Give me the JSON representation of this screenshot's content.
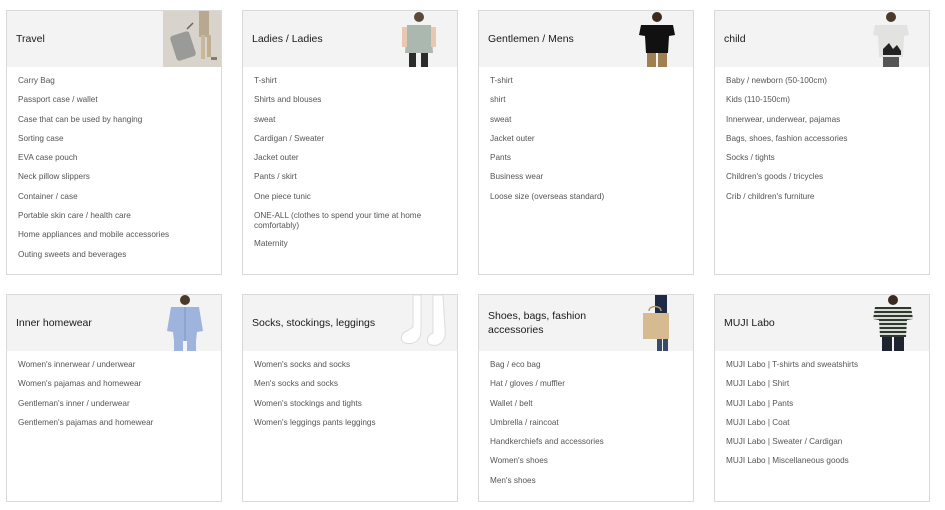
{
  "categories": [
    {
      "title": "Travel",
      "image": "suitcase-traveler",
      "items": [
        "Carry Bag",
        "Passport case / wallet",
        "Case that can be used by hanging",
        "Sorting case",
        "EVA case pouch",
        "Neck pillow slippers",
        "Container / case",
        "Portable skin care / health care",
        "Home appliances and mobile accessories",
        "Outing sweets and beverages"
      ]
    },
    {
      "title": "Ladies / Ladies",
      "image": "woman-grey-top",
      "items": [
        "T-shirt",
        "Shirts and blouses",
        "sweat",
        "Cardigan / Sweater",
        "Jacket outer",
        "Pants / skirt",
        "One piece tunic",
        "ONE-ALL (clothes to spend your time at home comfortably)",
        "Maternity"
      ]
    },
    {
      "title": "Gentlemen / Mens",
      "image": "man-black-tshirt",
      "items": [
        "T-shirt",
        "shirt",
        "sweat",
        "Jacket outer",
        "Pants",
        "Business wear",
        "Loose size (overseas standard)"
      ]
    },
    {
      "title": "child",
      "image": "child-print-tshirt",
      "items": [
        "Baby / newborn (50-100cm)",
        "Kids (110-150cm)",
        "Innerwear, underwear, pajamas",
        "Bags, shoes, fashion accessories",
        "Socks / tights",
        "Children's goods / tricycles",
        "Crib / children's furniture"
      ]
    },
    {
      "title": "Inner homewear",
      "image": "blue-pajamas",
      "items": [
        "Women's innerwear / underwear",
        "Women's pajamas and homewear",
        "Gentleman's inner / underwear",
        "Gentlemen's pajamas and homewear"
      ]
    },
    {
      "title": "Socks, stockings, leggings",
      "image": "white-socks",
      "items": [
        "Women's socks and socks",
        "Men's socks and socks",
        "Women's stockings and tights",
        "Women's leggings pants leggings"
      ]
    },
    {
      "title": "Shoes, bags, fashion accessories",
      "image": "tote-bag",
      "items": [
        "Bag / eco bag",
        "Hat / gloves / muffler",
        "Wallet / belt",
        "Umbrella / raincoat",
        "Handkerchiefs and accessories",
        "Women's shoes",
        "Men's shoes"
      ]
    },
    {
      "title": "MUJI Labo",
      "image": "striped-tshirt",
      "items": [
        "MUJI Labo | T-shirts and sweatshirts",
        "MUJI Labo | Shirt",
        "MUJI Labo | Pants",
        "MUJI Labo | Coat",
        "MUJI Labo | Sweater / Cardigan",
        "MUJI Labo | Miscellaneous goods"
      ]
    }
  ]
}
